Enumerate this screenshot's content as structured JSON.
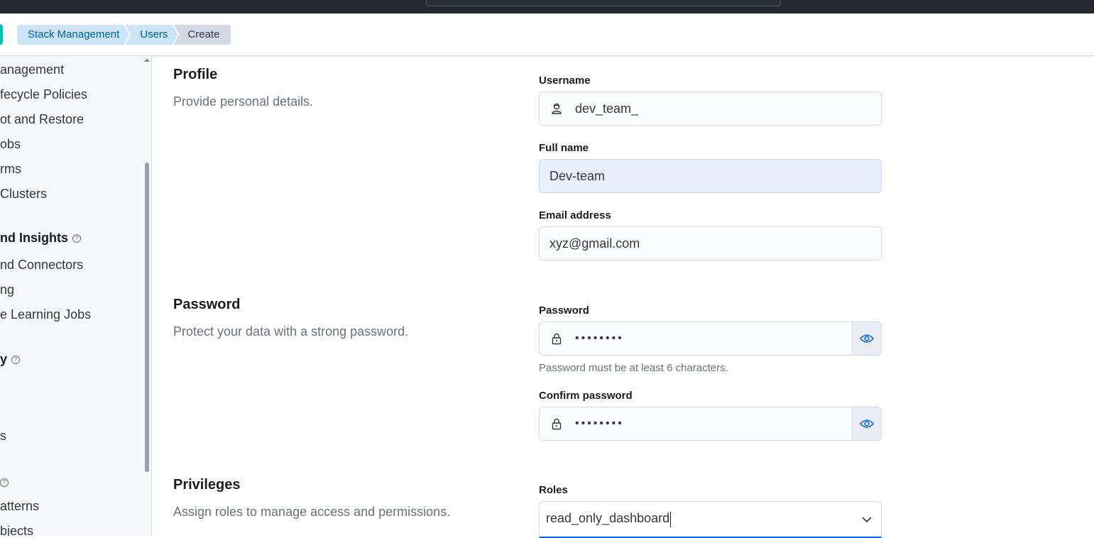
{
  "breadcrumbs": [
    {
      "label": "Stack Management"
    },
    {
      "label": "Users"
    },
    {
      "label": "Create"
    }
  ],
  "sidebar": {
    "items": [
      {
        "label": "anagement"
      },
      {
        "label": "fecycle Policies"
      },
      {
        "label": "ot and Restore"
      },
      {
        "label": "obs"
      },
      {
        "label": "rms"
      },
      {
        "label": " Clusters"
      }
    ],
    "section_alerts": {
      "title": "nd Insights"
    },
    "items2": [
      {
        "label": "nd Connectors"
      },
      {
        "label": "ng"
      },
      {
        "label": "e Learning Jobs"
      }
    ],
    "section_security": {
      "title": "y"
    },
    "items3": [
      {
        "label": "s"
      }
    ],
    "items4": [
      {
        "label": "atterns"
      },
      {
        "label": "bjects"
      }
    ]
  },
  "profile": {
    "title": "Profile",
    "description": "Provide personal details.",
    "username_label": "Username",
    "username_value": "dev_team_",
    "fullname_label": "Full name",
    "fullname_value": "Dev-team",
    "email_label": "Email address",
    "email_value": "xyz@gmail.com"
  },
  "password": {
    "title": "Password",
    "description": "Protect your data with a strong password.",
    "password_label": "Password",
    "password_value": "••••••••",
    "help_text": "Password must be at least 6 characters.",
    "confirm_label": "Confirm password",
    "confirm_value": "••••••••"
  },
  "privileges": {
    "title": "Privileges",
    "description": "Assign roles to manage access and permissions.",
    "roles_label": "Roles",
    "roles_value": "read_only_dashboard"
  },
  "colors": {
    "topbar": "#25282f",
    "breadcrumb_link_bg": "#cce4f5",
    "breadcrumb_link_text": "#0061a6",
    "autofill_bg": "#e8f0fe",
    "focus_accent": "#0b64dd",
    "eye_icon": "#0b64dd"
  }
}
